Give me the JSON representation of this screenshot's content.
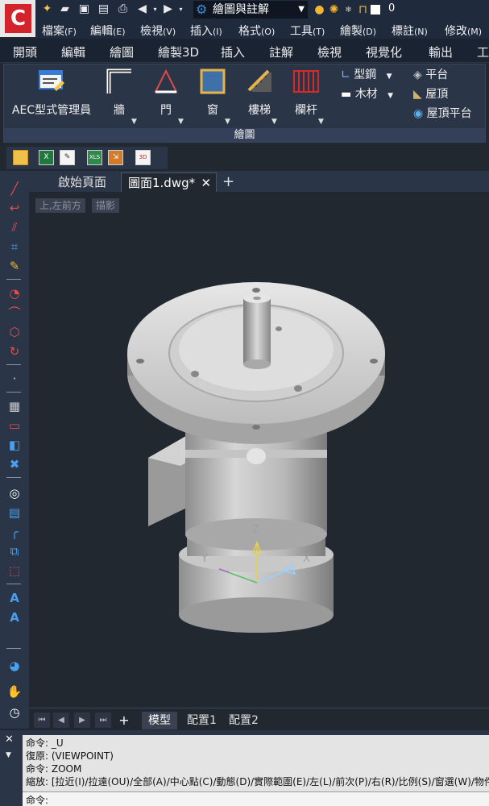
{
  "quick_access": {
    "workspace": "繪圖與註解",
    "layer_name": "0"
  },
  "menu": [
    {
      "label": "檔案",
      "key": "(F)"
    },
    {
      "label": "編輯",
      "key": "(E)"
    },
    {
      "label": "檢視",
      "key": "(V)"
    },
    {
      "label": "插入",
      "key": "(I)"
    },
    {
      "label": "格式",
      "key": "(O)"
    },
    {
      "label": "工具",
      "key": "(T)"
    },
    {
      "label": "繪製",
      "key": "(D)"
    },
    {
      "label": "標註",
      "key": "(N)"
    },
    {
      "label": "修改",
      "key": "(M)"
    }
  ],
  "ribbon_tabs": [
    "開頭",
    "編輯",
    "繪圖",
    "繪製3D",
    "插入",
    "註解",
    "檢視",
    "視覺化",
    "輸出",
    "工"
  ],
  "ribbon": {
    "aec_label": "AEC型式管理員",
    "wall": "牆",
    "door": "門",
    "window": "窗",
    "stair": "樓梯",
    "railing": "欄杆",
    "steel": "型鋼",
    "timber": "木材",
    "platform": "平台",
    "roof": "屋頂",
    "roof_slab": "屋頂平台",
    "panel_title": "繪圖"
  },
  "doc_tabs": {
    "start": "啟始頁面",
    "drawing": "圖面1.dwg*"
  },
  "viewport": {
    "view_label": "上,左前方",
    "style_label": "描影",
    "axis_x": "X",
    "axis_y": "Y",
    "axis_z": "Z"
  },
  "layout_tabs": [
    "模型",
    "配置1",
    "配置2"
  ],
  "command": {
    "history": [
      "命令: _U",
      "復原: (VIEWPOINT)",
      "命令: ZOOM",
      "縮放: [拉近(I)/拉遠(OU)/全部(A)/中心點(C)/動態(D)/實際範圍(E)/左(L)/前次(P)/右(R)/比例(S)/窗選(W)/物件(O)]"
    ],
    "prompt": "命令:"
  },
  "colors": {
    "accent_red": "#d4242b",
    "ucs_x": "#9ad0ff",
    "ucs_y": "#55c26a",
    "ucs_z": "#e8d04a"
  }
}
